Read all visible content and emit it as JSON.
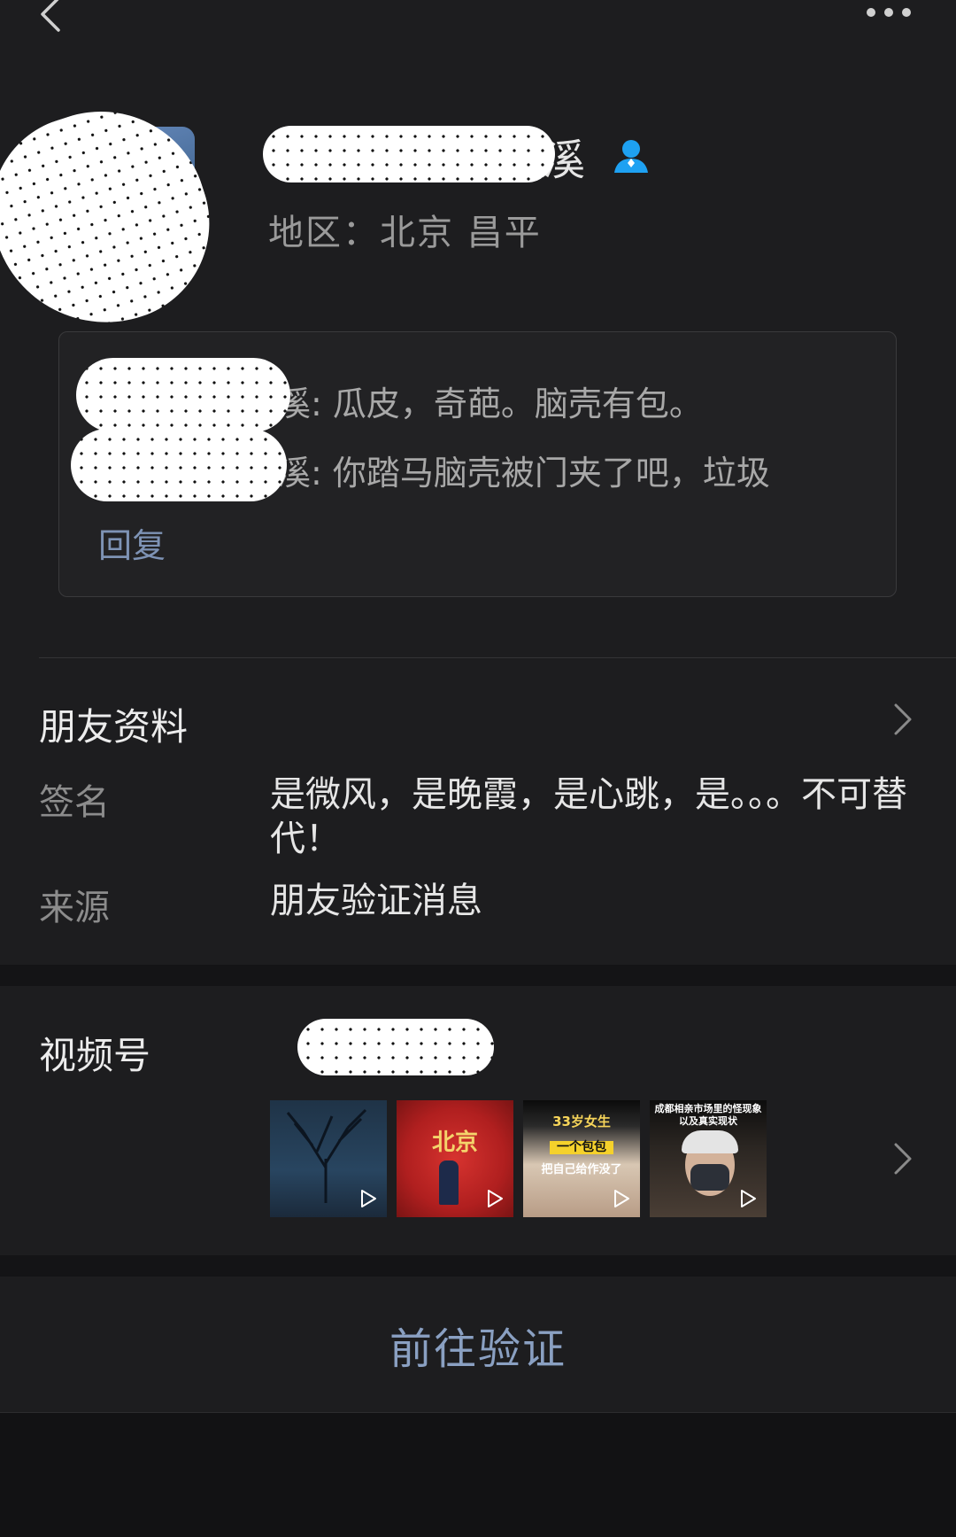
{
  "topbar": {
    "back_icon": "chevron-left-icon",
    "more_icon": "more-horizontal-icon"
  },
  "profile": {
    "name_visible_suffix": "溪",
    "badge_icon": "person-icon",
    "region": "地区：北京 昌平"
  },
  "messages": {
    "lines": [
      {
        "visible_text": "溪: 瓜皮，奇葩。脑壳有包。"
      },
      {
        "visible_text": "溪: 你踏马脑壳被门夹了吧，垃圾"
      }
    ],
    "reply_label": "回复"
  },
  "friend_info": {
    "title": "朋友资料",
    "signature_label": "签名",
    "signature_value": "是微风，是晚霞，是心跳，是。。。不可替代！",
    "source_label": "来源",
    "source_value": "朋友验证消息"
  },
  "channels": {
    "label": "视频号",
    "thumbnails": [
      {
        "caption_lines": []
      },
      {
        "caption_lines": [
          "北京"
        ]
      },
      {
        "caption_lines": [
          "33岁女生",
          "一个包包",
          "把自己给作没了"
        ]
      },
      {
        "caption_lines": [
          "成都相亲市场里的怪现象",
          "以及真实现状"
        ]
      }
    ]
  },
  "actions": {
    "verify_label": "前往验证"
  },
  "colors": {
    "background": "#1d1d1f",
    "link": "#7e93b5",
    "badge": "#1ea1f2"
  }
}
